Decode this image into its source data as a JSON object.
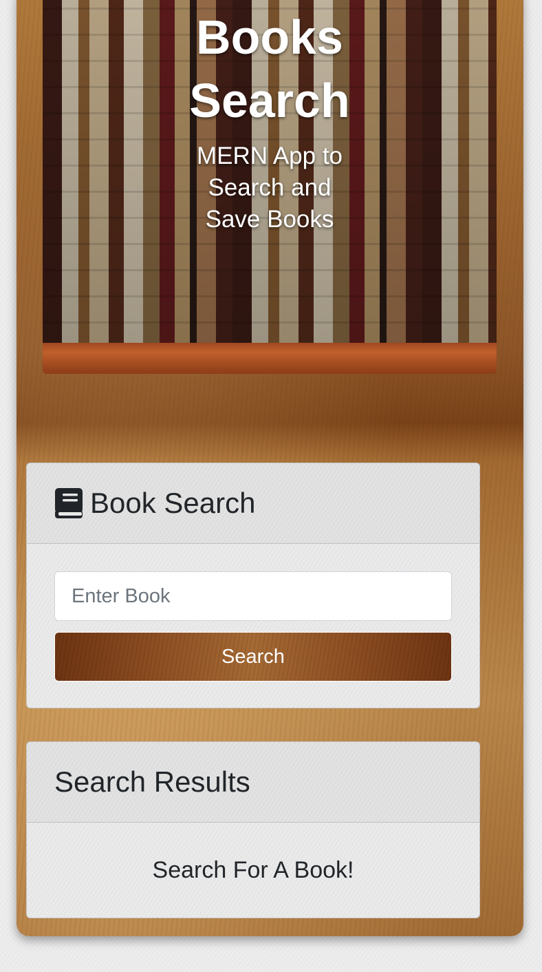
{
  "hero": {
    "title": "Books Search",
    "subtitle": "MERN App to Search and Save Books"
  },
  "search_card": {
    "icon": "book-icon",
    "title": "Book Search",
    "input_placeholder": "Enter Book",
    "input_value": "",
    "button_label": "Search"
  },
  "results_card": {
    "title": "Search Results",
    "empty_message": "Search For A Book!"
  },
  "colors": {
    "button_brown": "#8d4e22",
    "text_dark": "#212529",
    "hero_text": "#ffffff"
  }
}
